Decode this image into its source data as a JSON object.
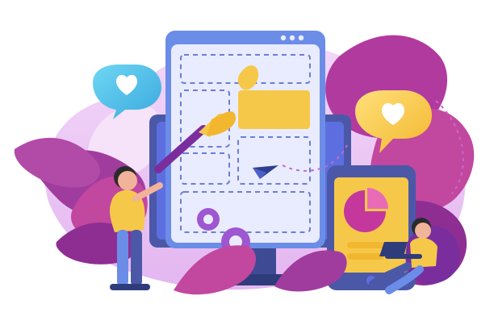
{
  "illustration": {
    "heart_icons": [
      "heart-icon",
      "heart-icon"
    ],
    "elements": [
      "browser-wireframe",
      "paint-brush",
      "paper-plane",
      "pie-chart",
      "laptop",
      "gears"
    ]
  },
  "colors": {
    "purple": "#7A2E9E",
    "magenta": "#C33A8E",
    "light_purple": "#E9C5F2",
    "blue_screen": "#6B8DE8",
    "yellow": "#F6C84A",
    "cyan": "#4FC3E6"
  }
}
